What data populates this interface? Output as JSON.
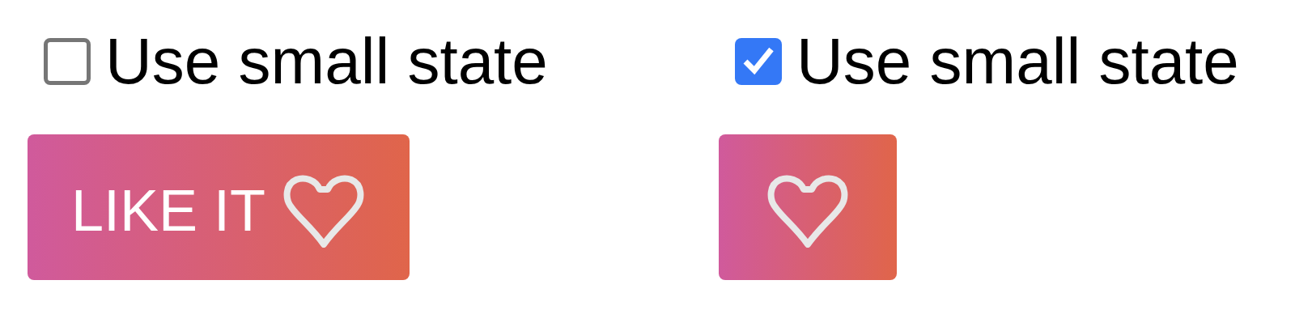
{
  "panels": [
    {
      "checkbox": {
        "label": "Use small state",
        "checked": false
      },
      "button": {
        "label": "LIKE IT"
      }
    },
    {
      "checkbox": {
        "label": "Use small state",
        "checked": true
      }
    }
  ]
}
